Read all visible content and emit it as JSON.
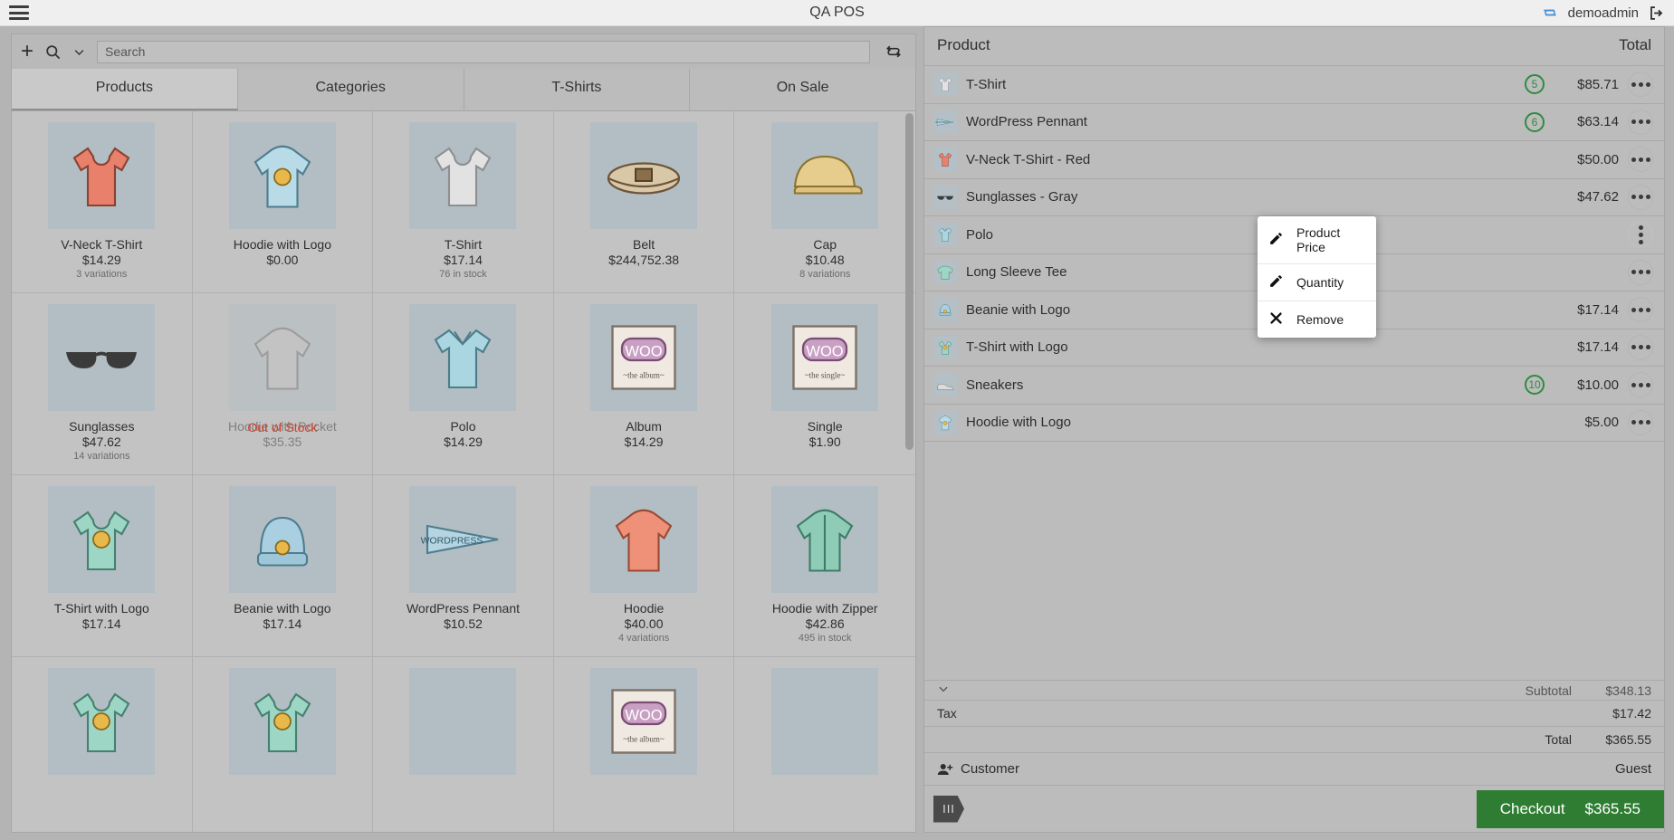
{
  "topbar": {
    "menu_icon": "hamburger-icon",
    "title": "QA POS",
    "sync_icon": "sync-icon",
    "user": "demoadmin",
    "logout_icon": "logout-icon"
  },
  "search": {
    "add_icon": "plus-icon",
    "search_icon": "search-icon",
    "dropdown_icon": "chevron-down-icon",
    "placeholder": "Search",
    "value": "",
    "refresh_icon": "refresh-icon"
  },
  "tabs": [
    {
      "label": "Products",
      "active": true
    },
    {
      "label": "Categories",
      "active": false
    },
    {
      "label": "T-Shirts",
      "active": false
    },
    {
      "label": "On Sale",
      "active": false
    }
  ],
  "products": [
    {
      "name": "V-Neck T-Shirt",
      "price": "$14.29",
      "meta": "3 variations",
      "icon": "tshirt-red",
      "out_of_stock": false
    },
    {
      "name": "Hoodie with Logo",
      "price": "$0.00",
      "meta": "",
      "icon": "hoodie-blue",
      "out_of_stock": false
    },
    {
      "name": "T-Shirt",
      "price": "$17.14",
      "meta": "76 in stock",
      "icon": "tshirt-gray",
      "out_of_stock": false
    },
    {
      "name": "Belt",
      "price": "$244,752.38",
      "meta": "",
      "icon": "belt",
      "out_of_stock": false
    },
    {
      "name": "Cap",
      "price": "$10.48",
      "meta": "8 variations",
      "icon": "cap",
      "out_of_stock": false
    },
    {
      "name": "Sunglasses",
      "price": "$47.62",
      "meta": "14 variations",
      "icon": "sunglasses",
      "out_of_stock": false
    },
    {
      "name": "Hoodie with Pocket",
      "price": "$35.35",
      "meta": "",
      "icon": "hoodie-gray",
      "out_of_stock": true,
      "oos_label": "Out of Stock"
    },
    {
      "name": "Polo",
      "price": "$14.29",
      "meta": "",
      "icon": "polo",
      "out_of_stock": false
    },
    {
      "name": "Album",
      "price": "$14.29",
      "meta": "",
      "icon": "album",
      "out_of_stock": false
    },
    {
      "name": "Single",
      "price": "$1.90",
      "meta": "",
      "icon": "single",
      "out_of_stock": false
    },
    {
      "name": "T-Shirt with Logo",
      "price": "$17.14",
      "meta": "",
      "icon": "tshirt-logo",
      "out_of_stock": false
    },
    {
      "name": "Beanie with Logo",
      "price": "$17.14",
      "meta": "",
      "icon": "beanie",
      "out_of_stock": false
    },
    {
      "name": "WordPress Pennant",
      "price": "$10.52",
      "meta": "",
      "icon": "pennant",
      "out_of_stock": false
    },
    {
      "name": "Hoodie",
      "price": "$40.00",
      "meta": "4 variations",
      "icon": "hoodie-orange",
      "out_of_stock": false
    },
    {
      "name": "Hoodie with Zipper",
      "price": "$42.86",
      "meta": "495 in stock",
      "icon": "hoodie-green",
      "out_of_stock": false
    },
    {
      "name": "",
      "price": "",
      "meta": "",
      "icon": "tshirt-logo",
      "out_of_stock": false
    },
    {
      "name": "",
      "price": "",
      "meta": "",
      "icon": "tshirt-logo",
      "out_of_stock": false
    },
    {
      "name": "",
      "price": "",
      "meta": "",
      "icon": "blank",
      "out_of_stock": false
    },
    {
      "name": "",
      "price": "",
      "meta": "",
      "icon": "album",
      "out_of_stock": false
    },
    {
      "name": "",
      "price": "",
      "meta": "",
      "icon": "blank",
      "out_of_stock": false
    }
  ],
  "cart": {
    "header": {
      "product": "Product",
      "total": "Total"
    },
    "items": [
      {
        "name": "T-Shirt",
        "qty": "5",
        "price": "$85.71",
        "icon": "tshirt-gray"
      },
      {
        "name": "WordPress Pennant",
        "qty": "6",
        "price": "$63.14",
        "icon": "pennant"
      },
      {
        "name": "V-Neck T-Shirt - Red",
        "qty": "",
        "price": "$50.00",
        "icon": "tshirt-red"
      },
      {
        "name": "Sunglasses - Gray",
        "qty": "",
        "price": "$47.62",
        "icon": "sunglasses"
      },
      {
        "name": "Polo",
        "qty": "",
        "price": "",
        "icon": "polo"
      },
      {
        "name": "Long Sleeve Tee",
        "qty": "",
        "price": "",
        "icon": "longsleeve"
      },
      {
        "name": "Beanie with Logo",
        "qty": "",
        "price": "$17.14",
        "icon": "beanie"
      },
      {
        "name": "T-Shirt with Logo",
        "qty": "",
        "price": "$17.14",
        "icon": "tshirt-logo"
      },
      {
        "name": "Sneakers",
        "qty": "10",
        "price": "$10.00",
        "icon": "sneakers"
      },
      {
        "name": "Hoodie with Logo",
        "qty": "",
        "price": "$5.00",
        "icon": "hoodie-blue"
      }
    ],
    "totals": {
      "collapse_icon": "chevron-down-icon",
      "subtotal_label": "Subtotal",
      "subtotal_value": "$348.13",
      "tax_label": "Tax",
      "tax_value": "$17.42",
      "total_label": "Total",
      "total_value": "$365.55"
    },
    "customer": {
      "icon": "add-customer-icon",
      "label": "Customer",
      "value": "Guest"
    },
    "hold_button": "III",
    "checkout": {
      "label": "Checkout",
      "amount": "$365.55"
    }
  },
  "context_menu": {
    "items": [
      {
        "label": "Product Price",
        "icon": "pencil-icon"
      },
      {
        "label": "Quantity",
        "icon": "pencil-icon"
      },
      {
        "label": "Remove",
        "icon": "close-x-icon"
      }
    ]
  },
  "colors": {
    "accent_green": "#2e7d32",
    "badge_green": "#2f8b3f",
    "oos_red": "#d4402b",
    "sync_blue": "#4a90d9"
  }
}
